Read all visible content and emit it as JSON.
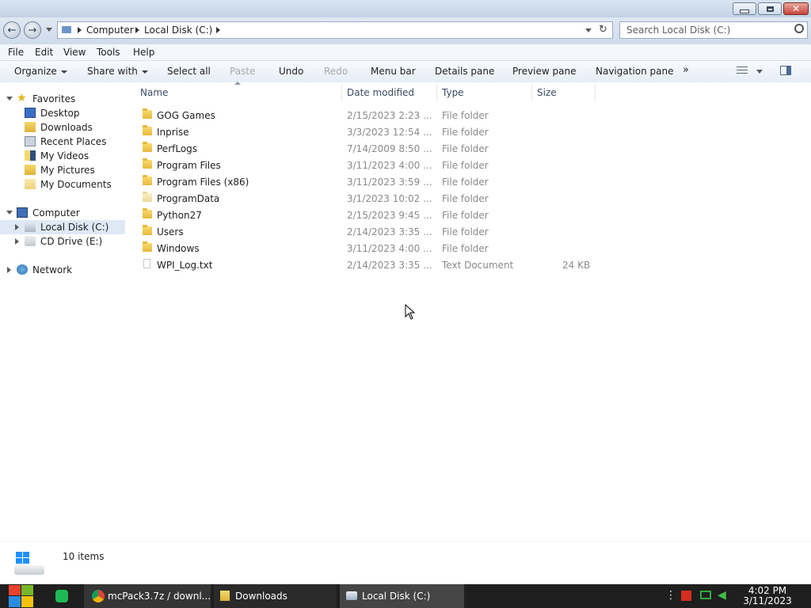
{
  "window": {
    "controls": [
      "minimize",
      "restore",
      "close"
    ]
  },
  "address": {
    "crumbs": [
      "Computer",
      "Local Disk (C:)"
    ],
    "search_placeholder": "Search Local Disk (C:)"
  },
  "menu": [
    "File",
    "Edit",
    "View",
    "Tools",
    "Help"
  ],
  "toolbar": {
    "organize": "Organize",
    "share_with": "Share with",
    "select_all": "Select all",
    "paste": "Paste",
    "undo": "Undo",
    "redo": "Redo",
    "menu_bar": "Menu bar",
    "details_pane": "Details pane",
    "preview_pane": "Preview pane",
    "navigation_pane": "Navigation pane",
    "more": "»"
  },
  "nav": {
    "favorites": "Favorites",
    "favorites_items": [
      "Desktop",
      "Downloads",
      "Recent Places",
      "My Videos",
      "My Pictures",
      "My Documents"
    ],
    "computer": "Computer",
    "local_disk": "Local Disk (C:)",
    "cd_drive": "CD Drive (E:)",
    "network": "Network"
  },
  "columns": [
    "Name",
    "Date modified",
    "Type",
    "Size"
  ],
  "files": [
    {
      "name": "GOG Games",
      "date": "2/15/2023 2:23 ...",
      "type": "File folder",
      "size": "",
      "icon": "folder"
    },
    {
      "name": "Inprise",
      "date": "3/3/2023 12:54 ...",
      "type": "File folder",
      "size": "",
      "icon": "folder"
    },
    {
      "name": "PerfLogs",
      "date": "7/14/2009 8:50 ...",
      "type": "File folder",
      "size": "",
      "icon": "folder"
    },
    {
      "name": "Program Files",
      "date": "3/11/2023 4:00 ...",
      "type": "File folder",
      "size": "",
      "icon": "folder"
    },
    {
      "name": "Program Files (x86)",
      "date": "3/11/2023 3:59 ...",
      "type": "File folder",
      "size": "",
      "icon": "folder"
    },
    {
      "name": "ProgramData",
      "date": "3/1/2023 10:02 ...",
      "type": "File folder",
      "size": "",
      "icon": "folder-faded"
    },
    {
      "name": "Python27",
      "date": "2/15/2023 9:45 ...",
      "type": "File folder",
      "size": "",
      "icon": "folder"
    },
    {
      "name": "Users",
      "date": "2/14/2023 3:35 ...",
      "type": "File folder",
      "size": "",
      "icon": "folder"
    },
    {
      "name": "Windows",
      "date": "3/11/2023 4:00 ...",
      "type": "File folder",
      "size": "",
      "icon": "folder"
    },
    {
      "name": "WPI_Log.txt",
      "date": "2/14/2023 3:35 ...",
      "type": "Text Document",
      "size": "24 KB",
      "icon": "text-document"
    }
  ],
  "status": {
    "item_count": "10 items"
  },
  "taskbar": {
    "tasks": [
      {
        "label": "mcPack3.7z / downl...",
        "icon": "chrome-icon"
      },
      {
        "label": "Downloads",
        "icon": "folder-icon"
      },
      {
        "label": "Local Disk (C:)",
        "icon": "drive-icon"
      }
    ],
    "time": "4:02 PM",
    "date": "3/11/2023"
  },
  "colors": {
    "accent": "#dfe9f6",
    "taskbar": "#1f1f1f"
  }
}
